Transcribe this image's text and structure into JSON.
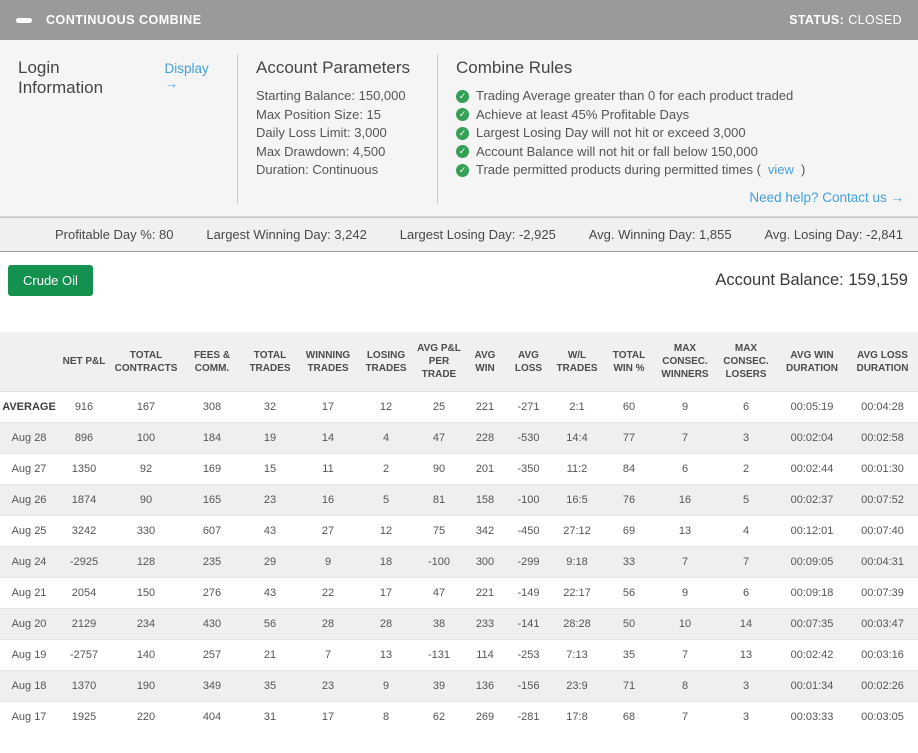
{
  "header": {
    "title": "CONTINUOUS COMBINE",
    "status_label": "STATUS:",
    "status_value": "CLOSED"
  },
  "login": {
    "title": "Login Information",
    "display_link": "Display →"
  },
  "account_parameters": {
    "title": "Account Parameters",
    "items": [
      "Starting Balance: 150,000",
      "Max Position Size: 15",
      "Daily Loss Limit: 3,000",
      "Max Drawdown: 4,500",
      "Duration: Continuous"
    ]
  },
  "combine_rules": {
    "title": "Combine Rules",
    "rules": [
      {
        "text": "Trading Average greater than 0 for each product traded"
      },
      {
        "text": "Achieve at least 45% Profitable Days"
      },
      {
        "text": "Largest Losing Day will not hit or exceed 3,000"
      },
      {
        "text": "Account Balance will not hit or fall below 150,000"
      },
      {
        "text": "Trade permitted products during permitted times (",
        "link": "view",
        "suffix": ")"
      }
    ],
    "help_link": "Need help? Contact us →"
  },
  "stats": [
    "Profitable Day %: 80",
    "Largest Winning Day: 3,242",
    "Largest Losing Day: -2,925",
    "Avg. Winning Day: 1,855",
    "Avg. Losing Day: -2,841"
  ],
  "product_button": "Crude Oil",
  "account_balance": "Account Balance: 159,159",
  "table": {
    "columns": [
      "",
      "NET P&L",
      "TOTAL CONTRACTS",
      "FEES & COMM.",
      "TOTAL TRADES",
      "WINNING TRADES",
      "LOSING TRADES",
      "AVG P&L PER TRADE",
      "AVG WIN",
      "AVG LOSS",
      "W/L TRADES",
      "TOTAL WIN %",
      "MAX CONSEC. WINNERS",
      "MAX CONSEC. LOSERS",
      "AVG WIN DURATION",
      "AVG LOSS DURATION"
    ],
    "rows": [
      [
        "AVERAGE",
        "916",
        "167",
        "308",
        "32",
        "17",
        "12",
        "25",
        "221",
        "-271",
        "2:1",
        "60",
        "9",
        "6",
        "00:05:19",
        "00:04:28"
      ],
      [
        "Aug 28",
        "896",
        "100",
        "184",
        "19",
        "14",
        "4",
        "47",
        "228",
        "-530",
        "14:4",
        "77",
        "7",
        "3",
        "00:02:04",
        "00:02:58"
      ],
      [
        "Aug 27",
        "1350",
        "92",
        "169",
        "15",
        "11",
        "2",
        "90",
        "201",
        "-350",
        "11:2",
        "84",
        "6",
        "2",
        "00:02:44",
        "00:01:30"
      ],
      [
        "Aug 26",
        "1874",
        "90",
        "165",
        "23",
        "16",
        "5",
        "81",
        "158",
        "-100",
        "16:5",
        "76",
        "16",
        "5",
        "00:02:37",
        "00:07:52"
      ],
      [
        "Aug 25",
        "3242",
        "330",
        "607",
        "43",
        "27",
        "12",
        "75",
        "342",
        "-450",
        "27:12",
        "69",
        "13",
        "4",
        "00:12:01",
        "00:07:40"
      ],
      [
        "Aug 24",
        "-2925",
        "128",
        "235",
        "29",
        "9",
        "18",
        "-100",
        "300",
        "-299",
        "9:18",
        "33",
        "7",
        "7",
        "00:09:05",
        "00:04:31"
      ],
      [
        "Aug 21",
        "2054",
        "150",
        "276",
        "43",
        "22",
        "17",
        "47",
        "221",
        "-149",
        "22:17",
        "56",
        "9",
        "6",
        "00:09:18",
        "00:07:39"
      ],
      [
        "Aug 20",
        "2129",
        "234",
        "430",
        "56",
        "28",
        "28",
        "38",
        "233",
        "-141",
        "28:28",
        "50",
        "10",
        "14",
        "00:07:35",
        "00:03:47"
      ],
      [
        "Aug 19",
        "-2757",
        "140",
        "257",
        "21",
        "7",
        "13",
        "-131",
        "114",
        "-253",
        "7:13",
        "35",
        "7",
        "13",
        "00:02:42",
        "00:03:16"
      ],
      [
        "Aug 18",
        "1370",
        "190",
        "349",
        "35",
        "23",
        "9",
        "39",
        "136",
        "-156",
        "23:9",
        "71",
        "8",
        "3",
        "00:01:34",
        "00:02:26"
      ],
      [
        "Aug 17",
        "1925",
        "220",
        "404",
        "31",
        "17",
        "8",
        "62",
        "269",
        "-281",
        "17:8",
        "68",
        "7",
        "3",
        "00:03:33",
        "00:03:05"
      ]
    ]
  },
  "colors": {
    "topbar_bg": "#9a9a9a",
    "link_blue": "#42a0dc",
    "check_green": "#33a153",
    "product_button_green": "#13914e"
  }
}
